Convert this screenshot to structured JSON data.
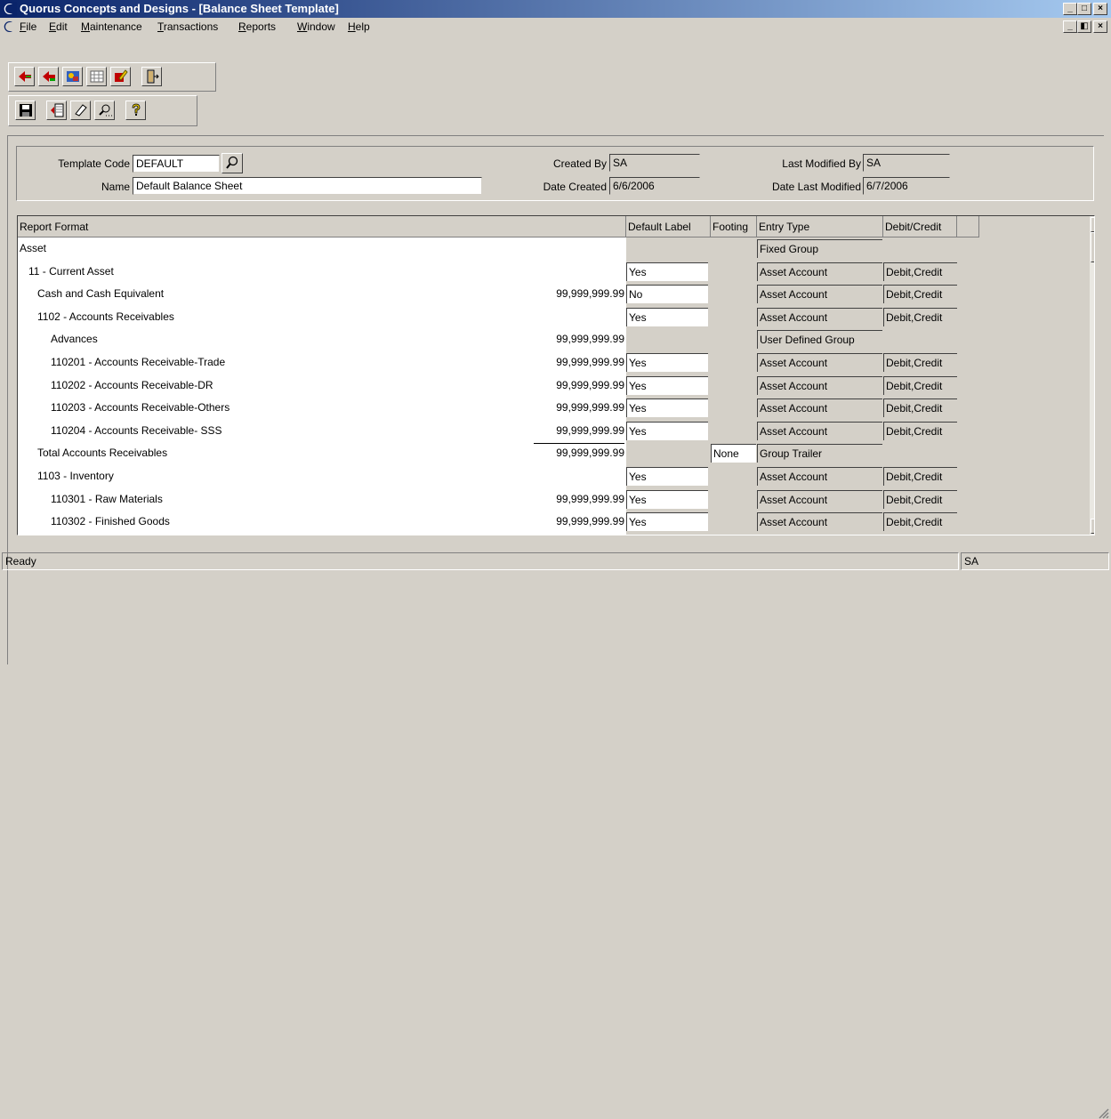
{
  "window": {
    "title": "Quorus Concepts and Designs - [Balance Sheet Template]",
    "caption_buttons": {
      "minimize": "_",
      "restore": "□",
      "close": "×"
    },
    "mdi_buttons": {
      "minimize": "_",
      "restore": "◧",
      "close": "×"
    }
  },
  "menu": {
    "items": [
      {
        "u": "F",
        "rest": "ile"
      },
      {
        "u": "E",
        "rest": "dit"
      },
      {
        "u": "M",
        "rest": "aintenance"
      },
      {
        "u": "T",
        "rest": "ransactions"
      },
      {
        "u": "R",
        "rest": "eports"
      },
      {
        "u": "W",
        "rest": "indow"
      },
      {
        "u": "H",
        "rest": "elp"
      }
    ]
  },
  "toolbar1": {
    "icons": [
      "back-icon",
      "previous-icon",
      "image-icon",
      "calendar-icon",
      "edit-icon",
      "exit-icon"
    ]
  },
  "toolbar2": {
    "icons": [
      "save-icon",
      "new-icon",
      "eraser-icon",
      "find-icon",
      "help-icon"
    ]
  },
  "header": {
    "template_code_label": "Template Code",
    "template_code": "DEFAULT",
    "name_label": "Name",
    "name": "Default Balance Sheet",
    "created_by_label": "Created By",
    "created_by": "SA",
    "date_created_label": "Date Created",
    "date_created": "6/6/2006",
    "last_modified_by_label": "Last Modified By",
    "last_modified_by": "SA",
    "date_last_modified_label": "Date Last Modified",
    "date_last_modified": "6/7/2006"
  },
  "grid": {
    "columns": [
      "Report Format",
      "Default Label",
      "Footing",
      "Entry Type",
      "Debit/Credit"
    ],
    "rows": [
      {
        "label": "Asset",
        "indent": 0,
        "amount": "",
        "default_label": "",
        "footing": "",
        "entry_type": "Fixed Group",
        "debit_credit": ""
      },
      {
        "label": "11 - Current Asset",
        "indent": 1,
        "amount": "",
        "default_label": "Yes",
        "footing": "",
        "entry_type": "Asset Account",
        "debit_credit": "Debit,Credit"
      },
      {
        "label": "Cash and Cash Equivalent",
        "indent": 2,
        "amount": "99,999,999.99",
        "default_label": "No",
        "footing": "",
        "entry_type": "Asset Account",
        "debit_credit": "Debit,Credit"
      },
      {
        "label": "1102 - Accounts Receivables",
        "indent": 2,
        "amount": "",
        "default_label": "Yes",
        "footing": "",
        "entry_type": "Asset Account",
        "debit_credit": "Debit,Credit"
      },
      {
        "label": "Advances",
        "indent": 3,
        "amount": "99,999,999.99",
        "default_label": "",
        "footing": "",
        "entry_type": "User Defined Group",
        "debit_credit": ""
      },
      {
        "label": "110201 - Accounts Receivable-Trade",
        "indent": 3,
        "amount": "99,999,999.99",
        "default_label": "Yes",
        "footing": "",
        "entry_type": "Asset Account",
        "debit_credit": "Debit,Credit"
      },
      {
        "label": "110202 - Accounts Receivable-DR",
        "indent": 3,
        "amount": "99,999,999.99",
        "default_label": "Yes",
        "footing": "",
        "entry_type": "Asset Account",
        "debit_credit": "Debit,Credit"
      },
      {
        "label": "110203 - Accounts Receivable-Others",
        "indent": 3,
        "amount": "99,999,999.99",
        "default_label": "Yes",
        "footing": "",
        "entry_type": "Asset Account",
        "debit_credit": "Debit,Credit"
      },
      {
        "label": "110204 - Accounts Receivable- SSS",
        "indent": 3,
        "amount": "99,999,999.99",
        "default_label": "Yes",
        "footing": "",
        "entry_type": "Asset Account",
        "debit_credit": "Debit,Credit"
      },
      {
        "label": "Total Accounts Receivables",
        "indent": 2,
        "amount": "99,999,999.99",
        "default_label": "",
        "footing": "None",
        "entry_type": "Group Trailer",
        "debit_credit": "",
        "overline": true
      },
      {
        "label": "1103 - Inventory",
        "indent": 2,
        "amount": "",
        "default_label": "Yes",
        "footing": "",
        "entry_type": "Asset Account",
        "debit_credit": "Debit,Credit"
      },
      {
        "label": "110301 - Raw Materials",
        "indent": 3,
        "amount": "99,999,999.99",
        "default_label": "Yes",
        "footing": "",
        "entry_type": "Asset Account",
        "debit_credit": "Debit,Credit"
      },
      {
        "label": "110302 - Finished Goods",
        "indent": 3,
        "amount": "99,999,999.99",
        "default_label": "Yes",
        "footing": "",
        "entry_type": "Asset Account",
        "debit_credit": "Debit,Credit"
      }
    ]
  },
  "status": {
    "text": "Ready",
    "user": "SA"
  }
}
